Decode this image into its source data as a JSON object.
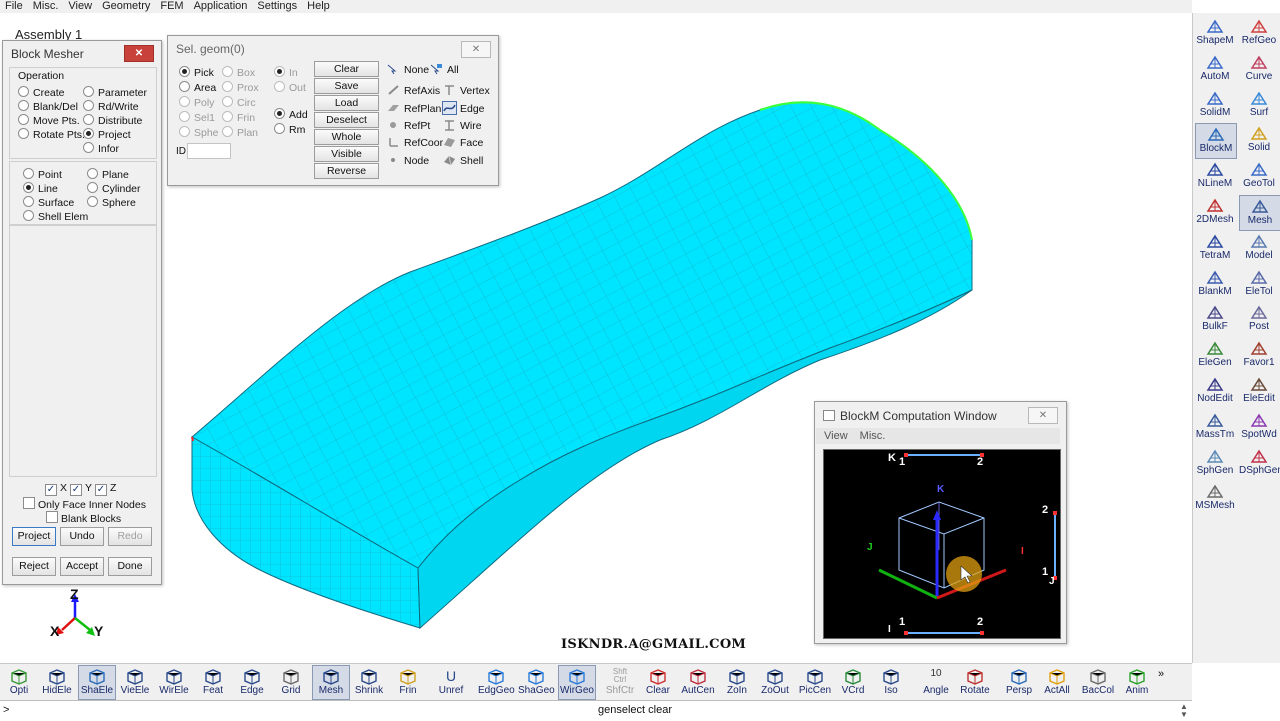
{
  "menubar": {
    "items": [
      "File",
      "Misc.",
      "View",
      "Geometry",
      "FEM",
      "Application",
      "Settings",
      "Help"
    ]
  },
  "assembly_label": "Assembly 1",
  "viewport": {
    "model_color": "#00e5ff",
    "mesh_line_color": "#1a9ab4",
    "axis_labels": {
      "z": "Z",
      "x": "X",
      "y": "Y"
    },
    "credit": "ISKNDR.A@GMAIL.COM"
  },
  "block_mesher": {
    "title": "Block Mesher",
    "operation_label": "Operation",
    "operations": [
      {
        "label": "Create",
        "selected": false
      },
      {
        "label": "Parameter",
        "selected": false
      },
      {
        "label": "Blank/Del",
        "selected": false
      },
      {
        "label": "Rd/Write",
        "selected": false
      },
      {
        "label": "Move Pts.",
        "selected": false
      },
      {
        "label": "Distribute",
        "selected": false
      },
      {
        "label": "Rotate Pts.",
        "selected": false
      },
      {
        "label": "Project",
        "selected": true
      },
      {
        "label": "Infor",
        "selected": false
      }
    ],
    "targets": [
      {
        "label": "Point",
        "selected": false
      },
      {
        "label": "Plane",
        "selected": false
      },
      {
        "label": "Line",
        "selected": true
      },
      {
        "label": "Cylinder",
        "selected": false
      },
      {
        "label": "Surface",
        "selected": false
      },
      {
        "label": "Sphere",
        "selected": false
      },
      {
        "label": "Shell Elem",
        "selected": false
      }
    ],
    "axes": [
      {
        "label": "X",
        "checked": true
      },
      {
        "label": "Y",
        "checked": true
      },
      {
        "label": "Z",
        "checked": true
      }
    ],
    "only_face_inner_nodes": "Only Face Inner Nodes",
    "blank_blocks": "Blank Blocks",
    "buttons": {
      "project": "Project",
      "undo": "Undo",
      "redo": "Redo",
      "reject": "Reject",
      "accept": "Accept",
      "done": "Done"
    }
  },
  "sel_geom": {
    "title": "Sel. geom(0)",
    "modes": [
      {
        "label": "Pick",
        "selected": true,
        "enabled": true
      },
      {
        "label": "Box",
        "selected": false,
        "enabled": false
      },
      {
        "label": "Area",
        "selected": false,
        "enabled": true
      },
      {
        "label": "Prox",
        "selected": false,
        "enabled": false
      },
      {
        "label": "Poly",
        "selected": false,
        "enabled": false
      },
      {
        "label": "Circ",
        "selected": false,
        "enabled": false
      },
      {
        "label": "Sel1",
        "selected": false,
        "enabled": false
      },
      {
        "label": "Frin",
        "selected": false,
        "enabled": false
      },
      {
        "label": "Sphe",
        "selected": false,
        "enabled": false
      },
      {
        "label": "Plan",
        "selected": false,
        "enabled": false
      }
    ],
    "inout": [
      {
        "label": "In",
        "selected": true,
        "enabled": false
      },
      {
        "label": "Out",
        "selected": false,
        "enabled": false
      }
    ],
    "addrm": [
      {
        "label": "Add",
        "selected": true
      },
      {
        "label": "Rm",
        "selected": false
      }
    ],
    "id_label": "ID",
    "id_value": "",
    "buttons": [
      "Clear",
      "Save",
      "Load",
      "Deselect",
      "Whole",
      "Visible",
      "Reverse"
    ],
    "none_label": "None",
    "all_label": "All",
    "types_left": [
      "RefAxis",
      "RefPlan",
      "RefPt",
      "RefCoor",
      "Node"
    ],
    "types_right": [
      "Vertex",
      "Edge",
      "Wire",
      "Face",
      "Shell"
    ],
    "selected_type": "Edge"
  },
  "blockm_window": {
    "title": "BlockM Computation Window",
    "menu": [
      "View",
      "Misc."
    ],
    "labels": {
      "k_top": "K",
      "one_top": "1",
      "two_top": "2",
      "k_cube": "K",
      "j_left": "J",
      "i_right": "I",
      "two_right": "2",
      "one_right": "1",
      "j_right": "J",
      "one_bottom": "1",
      "two_bottom": "2",
      "i_bottom": "I"
    }
  },
  "right_toolbar": [
    {
      "label": "ShapeM",
      "icon": "shape-icon"
    },
    {
      "label": "RefGeo",
      "icon": "refgeo-icon"
    },
    {
      "label": "AutoM",
      "icon": "automesh-icon"
    },
    {
      "label": "Curve",
      "icon": "curve-icon"
    },
    {
      "label": "SolidM",
      "icon": "solidmesh-icon"
    },
    {
      "label": "Surf",
      "icon": "surface-icon"
    },
    {
      "label": "BlockM",
      "icon": "block-icon",
      "active": true
    },
    {
      "label": "Solid",
      "icon": "solid-icon"
    },
    {
      "label": "NLineM",
      "icon": "nline-icon"
    },
    {
      "label": "GeoTol",
      "icon": "geotol-icon"
    },
    {
      "label": "2DMesh",
      "icon": "mesh2d-icon"
    },
    {
      "label": "Mesh",
      "icon": "mesh-icon",
      "active": true
    },
    {
      "label": "TetraM",
      "icon": "tetra-icon"
    },
    {
      "label": "Model",
      "icon": "model-icon"
    },
    {
      "label": "BlankM",
      "icon": "blank-icon"
    },
    {
      "label": "EleTol",
      "icon": "eletol-icon"
    },
    {
      "label": "BulkF",
      "icon": "bulk-icon"
    },
    {
      "label": "Post",
      "icon": "post-icon"
    },
    {
      "label": "EleGen",
      "icon": "elegen-icon"
    },
    {
      "label": "Favor1",
      "icon": "favorite-icon"
    },
    {
      "label": "NodEdit",
      "icon": "node-edit-icon"
    },
    {
      "label": "EleEdit",
      "icon": "element-edit-icon"
    },
    {
      "label": "MassTm",
      "icon": "mass-icon"
    },
    {
      "label": "SpotWd",
      "icon": "spotweld-icon"
    },
    {
      "label": "SphGen",
      "icon": "sphere-gen-icon"
    },
    {
      "label": "DSphGen",
      "icon": "dsphere-gen-icon"
    },
    {
      "label": "MSMesh",
      "icon": "msmesh-icon"
    }
  ],
  "bottom_toolbar": [
    {
      "label": "Opti",
      "icon": "optimize-icon"
    },
    {
      "label": "HidEle",
      "icon": "hide-element-icon"
    },
    {
      "label": "ShaEle",
      "icon": "shade-element-icon",
      "active": true
    },
    {
      "label": "VieEle",
      "icon": "view-element-icon"
    },
    {
      "label": "WirEle",
      "icon": "wire-element-icon"
    },
    {
      "label": "Feat",
      "icon": "feature-icon"
    },
    {
      "label": "Edge",
      "icon": "edge-icon"
    },
    {
      "label": "Grid",
      "icon": "grid-icon"
    },
    {
      "label": "Mesh",
      "icon": "mesh-icon",
      "active": true
    },
    {
      "label": "Shrink",
      "icon": "shrink-icon"
    },
    {
      "label": "Frin",
      "icon": "fringe-icon"
    },
    {
      "label": "Unref",
      "icon": "unref-icon"
    },
    {
      "label": "EdgGeo",
      "icon": "edge-geo-icon"
    },
    {
      "label": "ShaGeo",
      "icon": "shade-geo-icon"
    },
    {
      "label": "WirGeo",
      "icon": "wire-geo-icon",
      "active": true
    },
    {
      "label": "ShfCtr",
      "icon": "shift-ctrl-icon",
      "dim": true
    },
    {
      "label": "Clear",
      "icon": "eraser-icon"
    },
    {
      "label": "AutCen",
      "icon": "auto-center-icon"
    },
    {
      "label": "ZoIn",
      "icon": "zoom-in-icon"
    },
    {
      "label": "ZoOut",
      "icon": "zoom-out-icon"
    },
    {
      "label": "PicCen",
      "icon": "pick-center-icon"
    },
    {
      "label": "VCrd",
      "icon": "globe-icon"
    },
    {
      "label": "Iso",
      "icon": "iso-view-icon"
    },
    {
      "label": "Angle",
      "icon": "angle-icon"
    },
    {
      "label": "Rotate",
      "icon": "rotate-icon"
    },
    {
      "label": "Persp",
      "icon": "perspective-icon"
    },
    {
      "label": "ActAll",
      "icon": "activate-all-icon"
    },
    {
      "label": "BacCol",
      "icon": "background-color-icon"
    },
    {
      "label": "Anim",
      "icon": "animation-icon"
    }
  ],
  "bottom_extra": {
    "unref_glyph": "U",
    "shfctr_top": "Shft",
    "shfctr_mid": "Ctrl",
    "angle_value": "10",
    "more": "»"
  },
  "command": {
    "prompt": ">",
    "message": "genselect clear"
  }
}
